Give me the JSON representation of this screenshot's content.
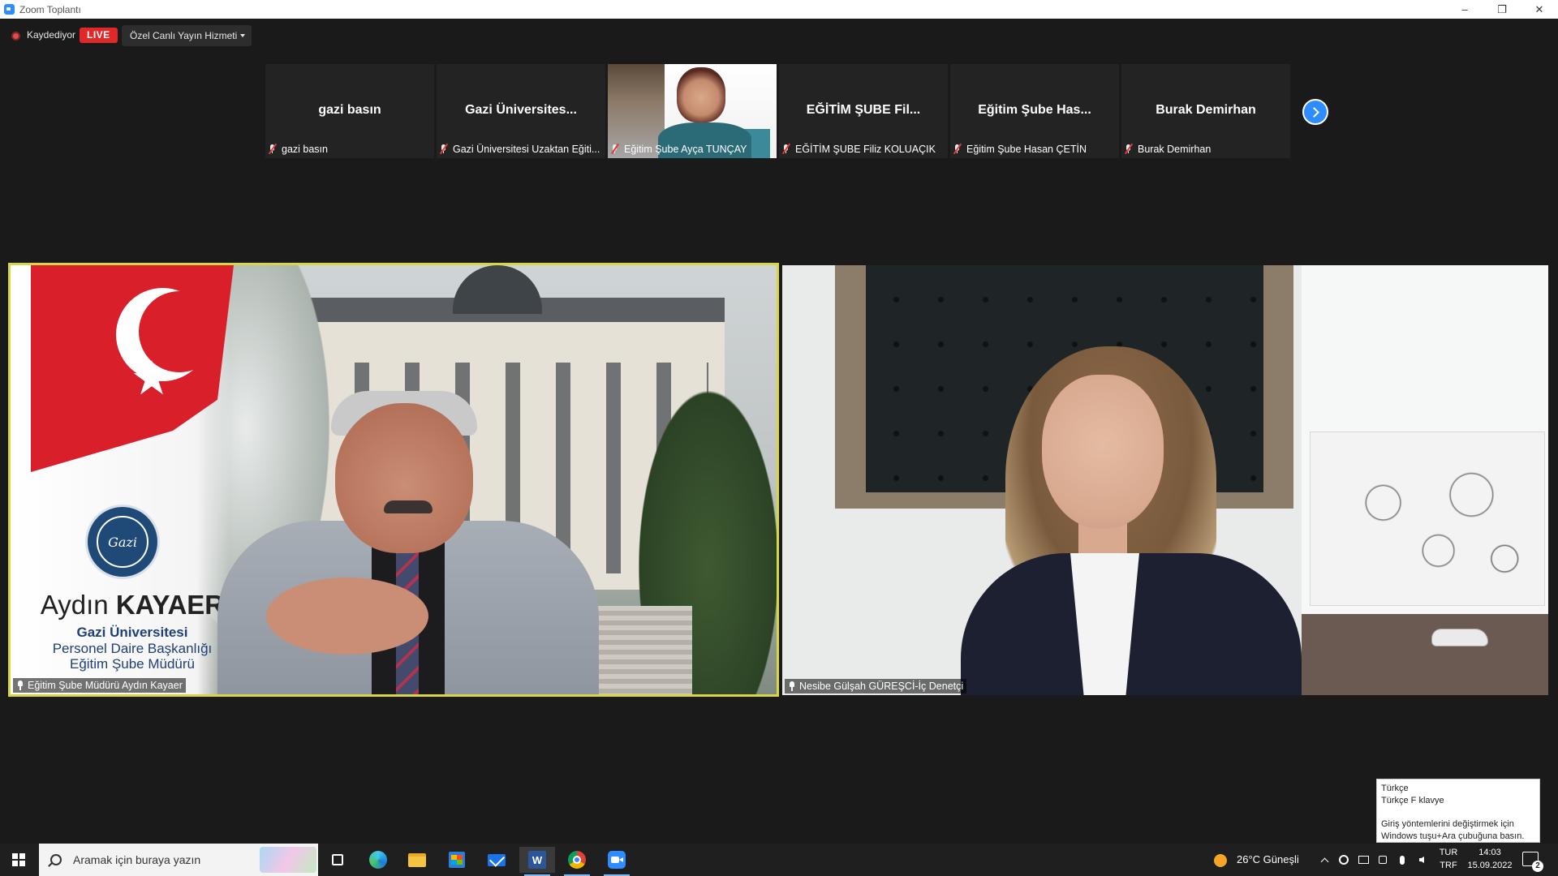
{
  "window": {
    "title": "Zoom Toplantı",
    "controls": {
      "minimize": "–",
      "restore": "❐",
      "close": "✕"
    }
  },
  "meeting_status": {
    "recording_label": "Kaydediyor",
    "live_badge": "LIVE",
    "stream_menu_label": "Özel Canlı Yayın Hizmeti"
  },
  "gallery": {
    "tiles": [
      {
        "display_name": "gazi basın",
        "caption": "gazi basın",
        "muted": true,
        "video": false
      },
      {
        "display_name": "Gazi Üniversites...",
        "caption": "Gazi Üniversitesi Uzaktan Eğiti...",
        "muted": true,
        "video": false
      },
      {
        "display_name": "",
        "caption": "Eğitim Şube Ayça TUNÇAY",
        "muted": true,
        "video": true
      },
      {
        "display_name": "EĞİTİM ŞUBE Fil...",
        "caption": "EĞİTİM ŞUBE Filiz KOLUAÇIK",
        "muted": true,
        "video": false
      },
      {
        "display_name": "Eğitim Şube Has...",
        "caption": "Eğitim Şube Hasan ÇETİN",
        "muted": true,
        "video": false
      },
      {
        "display_name": "Burak Demirhan",
        "caption": "Burak Demirhan",
        "muted": true,
        "video": false
      }
    ],
    "next_page_icon": "chevron-right-icon"
  },
  "main_videos": {
    "left": {
      "name_label": "Eğitim Şube Müdürü Aydın Kayaer",
      "active_speaker": true,
      "virtual_background": {
        "seal_text": "Gazi",
        "person_first": "Aydın",
        "person_last": "KAYAER",
        "line1": "Gazi Üniversitesi",
        "line2": "Personel Daire Başkanlığı",
        "line3": "Eğitim Şube Müdürü"
      }
    },
    "right": {
      "name_label": "Nesibe Gülşah GÜREŞCİ-İç Denetçi"
    }
  },
  "ime_tooltip": {
    "line1": "Türkçe",
    "line2": "Türkçe F klavye",
    "line3": "Giriş yöntemlerini değiştirmek için",
    "line4": "Windows tuşu+Ara çubuğuna basın."
  },
  "taskbar": {
    "search_placeholder": "Aramak için buraya yazın",
    "apps": [
      "task-view",
      "edge",
      "file-explorer",
      "microsoft-store",
      "mail",
      "word",
      "chrome",
      "zoom"
    ],
    "weather": "26°C  Güneşli",
    "language_top": "TUR",
    "language_bottom": "TRF",
    "time": "14:03",
    "date": "15.09.2022",
    "notification_count": "2"
  }
}
